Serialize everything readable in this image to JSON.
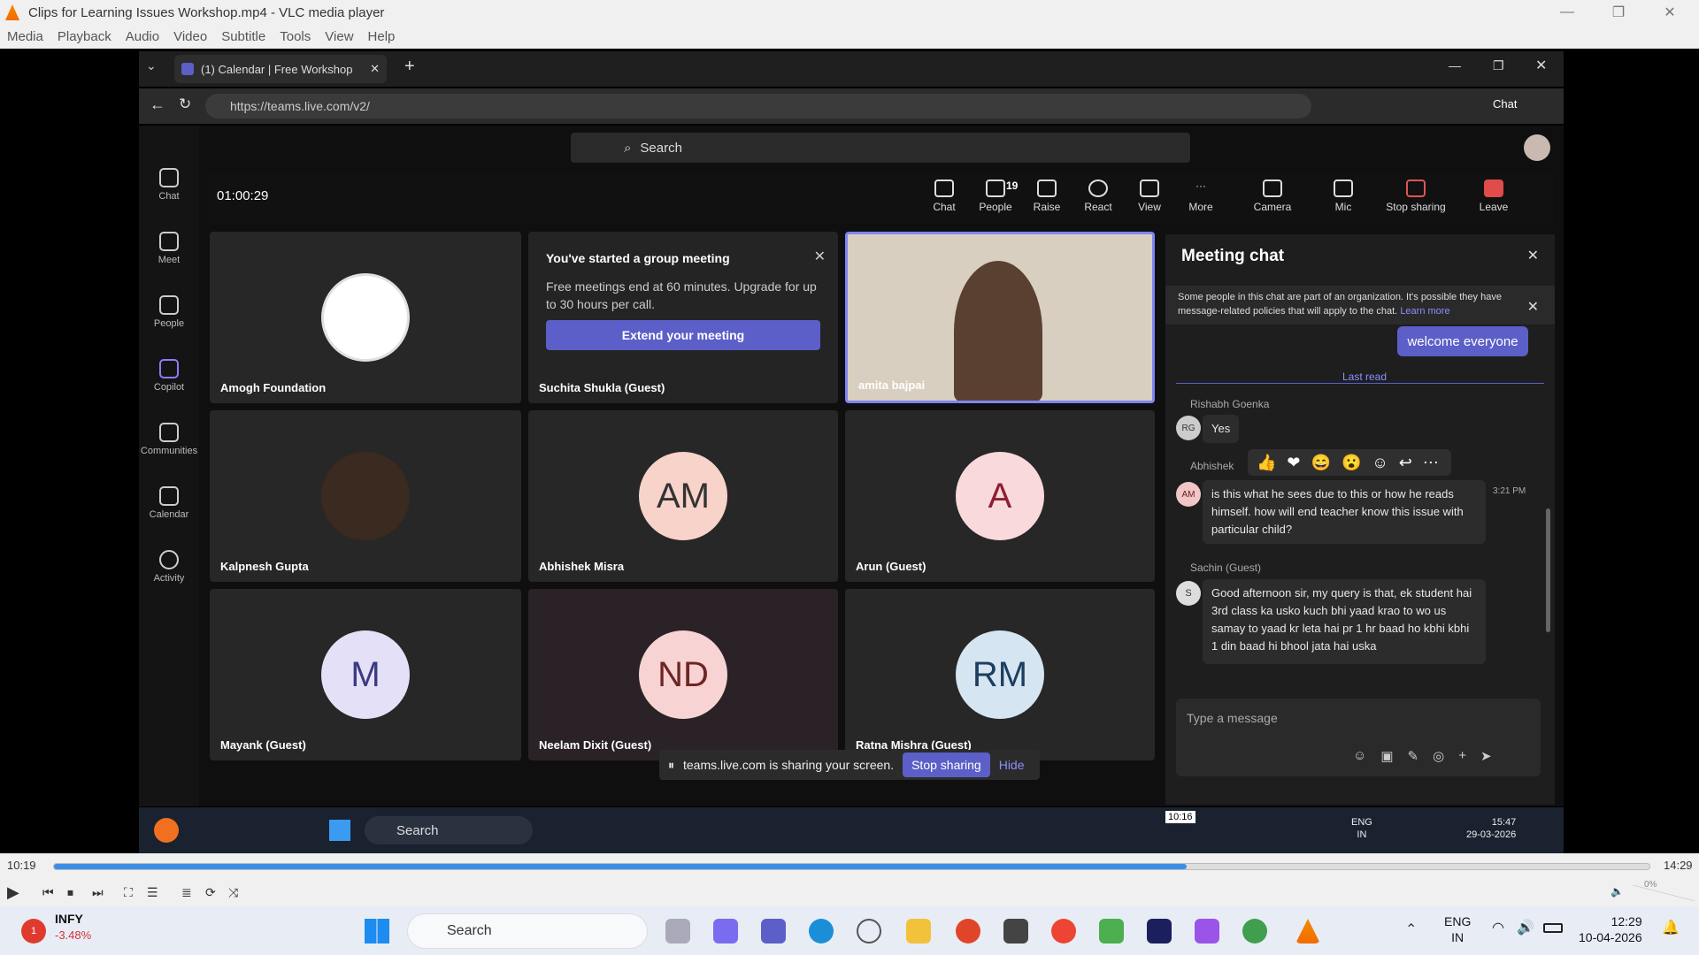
{
  "vlc": {
    "title": "Clips for Learning Issues Workshop.mp4 - VLC media player",
    "menu": [
      "Media",
      "Playback",
      "Audio",
      "Video",
      "Subtitle",
      "Tools",
      "View",
      "Help"
    ],
    "time_elapsed": "10:19",
    "time_total": "14:29",
    "progress": 0.71,
    "volume": "0%",
    "seek_tooltip": "10:16"
  },
  "browser": {
    "tab_title": "(1) Calendar | Free Workshop",
    "url": "https://teams.live.com/v2/",
    "chat_label": "Chat"
  },
  "teams": {
    "search_placeholder": "Search",
    "rail": [
      "Chat",
      "Meet",
      "People",
      "Copilot",
      "Communities",
      "Calendar",
      "Activity"
    ],
    "timer": "01:00:29",
    "toolbar": [
      "Chat",
      "People",
      "Raise",
      "React",
      "View",
      "More",
      "Camera",
      "Mic",
      "Stop sharing",
      "Leave"
    ],
    "people_count": "19",
    "tiles": [
      {
        "name": "Amogh Foundation",
        "initials": ""
      },
      {
        "name": "Suchita Shukla (Guest)",
        "initials": ""
      },
      {
        "name": "amita bajpai",
        "initials": ""
      },
      {
        "name": "Kalpnesh Gupta",
        "initials": ""
      },
      {
        "name": "Abhishek Misra",
        "initials": "AM"
      },
      {
        "name": "Arun (Guest)",
        "initials": "A"
      },
      {
        "name": "Mayank (Guest)",
        "initials": "M"
      },
      {
        "name": "Neelam Dixit (Guest)",
        "initials": "ND"
      },
      {
        "name": "Ratna Mishra (Guest)",
        "initials": "RM"
      }
    ],
    "notice": {
      "title": "You've started a group meeting",
      "body": "Free meetings end at 60 minutes. Upgrade for up to 30 hours per call.",
      "button": "Extend your meeting"
    },
    "chat": {
      "title": "Meeting chat",
      "banner": "Some people in this chat are part of an organization. It's possible they have message-related policies that will apply to the chat.",
      "banner_link": "Learn more",
      "my_msg": "welcome everyone",
      "last_read": "Last read",
      "m1_author": "Rishabh Goenka",
      "m1_initials": "RG",
      "m1_text": "Yes",
      "m2_author": "Abhishek",
      "m2_initials": "AM",
      "m2_time": "3:21 PM",
      "m2_text": "is this what he sees due to this or how he reads himself. how will end teacher know this issue with particular child?",
      "m3_author": "Sachin (Guest)",
      "m3_initials": "S",
      "m3_text": "Good afternoon sir, my query is that, ek student hai 3rd class ka usko kuch bhi yaad krao to wo us samay to yaad kr leta hai pr 1 hr baad ho kbhi kbhi 1 din baad hi bhool jata hai uska",
      "input_placeholder": "Type a message"
    },
    "share": {
      "text": "teams.live.com is sharing your screen.",
      "stop": "Stop sharing",
      "hide": "Hide"
    }
  },
  "inner_taskbar": {
    "search": "Search",
    "lang1": "ENG",
    "lang2": "IN",
    "time": "15:47",
    "date": "29-03-2026"
  },
  "taskbar": {
    "stock": "INFY",
    "stock_change": "-3.48%",
    "stock_badge": "1",
    "search": "Search",
    "lang1": "ENG",
    "lang2": "IN",
    "time": "12:29",
    "date": "10-04-2026"
  }
}
